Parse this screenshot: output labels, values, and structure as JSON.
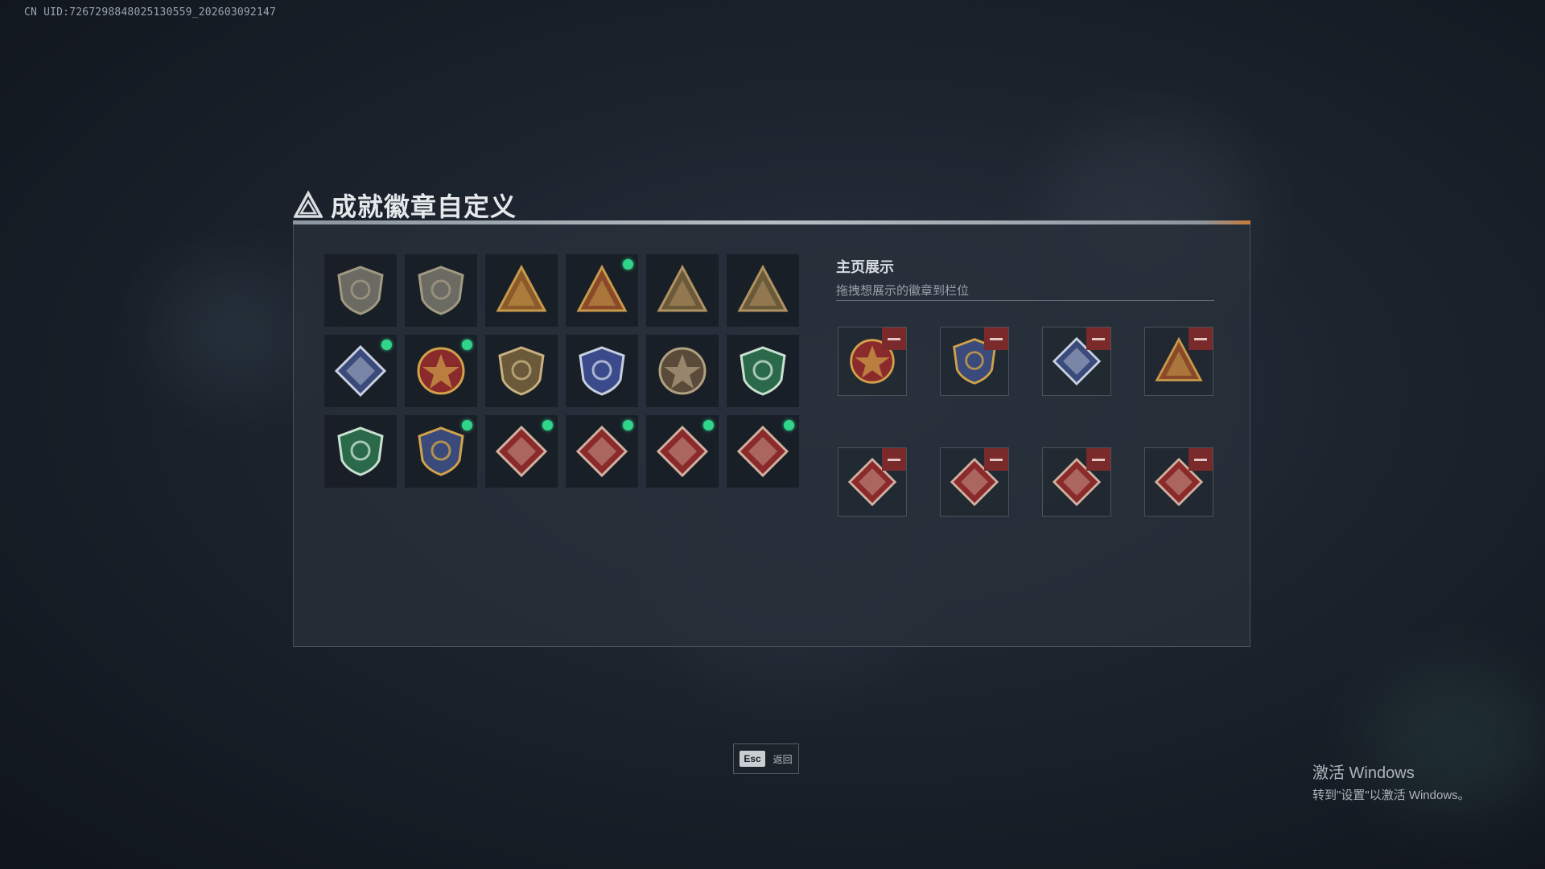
{
  "uid": "CN UID:7267298848025130559_202603092147",
  "panel": {
    "title": "成就徽章自定义",
    "icon": "triangle-logo-icon"
  },
  "badges": [
    {
      "icon": "shield-triangle-badge-icon",
      "new": false,
      "colors": [
        "#6b6a63",
        "#a19a82"
      ]
    },
    {
      "icon": "helicopter-badge-icon",
      "new": false,
      "colors": [
        "#6b6a63",
        "#a19a82"
      ]
    },
    {
      "icon": "number-one-triangle-badge-icon",
      "new": false,
      "colors": [
        "#8a5a2a",
        "#c79a4a"
      ]
    },
    {
      "icon": "box-triangle-badge-icon",
      "new": true,
      "colors": [
        "#8a4a2a",
        "#c79a4a"
      ]
    },
    {
      "icon": "soldiers-triangle-badge-icon",
      "new": false,
      "colors": [
        "#6a5a3a",
        "#b09262"
      ]
    },
    {
      "icon": "rocket-triangle-badge-icon",
      "new": false,
      "colors": [
        "#6a5a3a",
        "#b09262"
      ]
    },
    {
      "icon": "rifle-diamond-badge-icon",
      "new": true,
      "colors": [
        "#3a4a7a",
        "#c8d0e0"
      ]
    },
    {
      "icon": "star-medal-badge-icon",
      "new": true,
      "colors": [
        "#8a2a2a",
        "#d0a24a"
      ]
    },
    {
      "icon": "ribbon-shield-badge-icon",
      "new": false,
      "colors": [
        "#6a5a3a",
        "#c8b080"
      ]
    },
    {
      "icon": "police-shield-badge-icon",
      "new": false,
      "colors": [
        "#3a4a8a",
        "#c8d0e0"
      ]
    },
    {
      "icon": "skull-round-badge-icon",
      "new": false,
      "colors": [
        "#5a4a3a",
        "#b0a080"
      ]
    },
    {
      "icon": "green-crosshair-shield-badge-icon",
      "new": false,
      "colors": [
        "#2a6a4a",
        "#c8e0d0"
      ]
    },
    {
      "icon": "green-rifle-shield-badge-icon",
      "new": false,
      "colors": [
        "#2a6a4a",
        "#c8e0d0"
      ]
    },
    {
      "icon": "gold-rifle-shield-badge-icon",
      "new": true,
      "colors": [
        "#3a4a7a",
        "#d0a24a"
      ]
    },
    {
      "icon": "wolf-diamond-badge-icon",
      "new": true,
      "colors": [
        "#8a2a2a",
        "#d0b0a0"
      ]
    },
    {
      "icon": "dragon-diamond-badge-icon",
      "new": true,
      "colors": [
        "#8a2a2a",
        "#d0b0a0"
      ]
    },
    {
      "icon": "dragon-diamond-badge-icon",
      "new": true,
      "colors": [
        "#8a2a2a",
        "#d0b0a0"
      ]
    },
    {
      "icon": "runner-diamond-badge-icon",
      "new": true,
      "colors": [
        "#8a2a2a",
        "#d0b0a0"
      ]
    }
  ],
  "display": {
    "title": "主页展示",
    "subtitle": "拖拽想展示的徽章到栏位",
    "slots": [
      {
        "icon": "star-medal-badge-icon",
        "colors": [
          "#8a2a2a",
          "#d0a24a"
        ]
      },
      {
        "icon": "gold-rifle-shield-badge-icon",
        "colors": [
          "#3a4a7a",
          "#d0a24a"
        ]
      },
      {
        "icon": "rifle-diamond-badge-icon",
        "colors": [
          "#3a4a7a",
          "#c8d0e0"
        ]
      },
      {
        "icon": "box-triangle-badge-icon",
        "colors": [
          "#8a4a2a",
          "#c79a4a"
        ]
      },
      {
        "icon": "dragon-diamond-badge-icon",
        "colors": [
          "#8a2a2a",
          "#d0b0a0"
        ]
      },
      {
        "icon": "dragon-diamond-badge-icon",
        "colors": [
          "#8a2a2a",
          "#d0b0a0"
        ]
      },
      {
        "icon": "runner-diamond-badge-icon",
        "colors": [
          "#8a2a2a",
          "#d0b0a0"
        ]
      },
      {
        "icon": "wolf-diamond-badge-icon",
        "colors": [
          "#8a2a2a",
          "#d0b0a0"
        ]
      }
    ]
  },
  "esc": {
    "key": "Esc",
    "label": "返回"
  },
  "activation": {
    "title": "激活 Windows",
    "subtitle": "转到\"设置\"以激活 Windows。"
  },
  "colors": {
    "new_dot": "#2fd68a",
    "remove": "#7a2a2a",
    "accent": "#c87a3a"
  }
}
